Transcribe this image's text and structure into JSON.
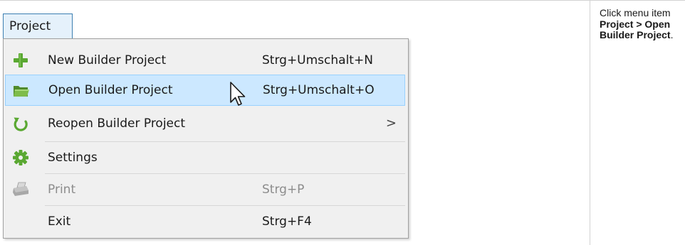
{
  "menubar": {
    "active_menu": "Project"
  },
  "menu": {
    "items": [
      {
        "label": "New Builder Project",
        "shortcut": "Strg+Umschalt+N",
        "icon": "plus-icon",
        "state": "normal"
      },
      {
        "label": "Open Builder Project",
        "shortcut": "Strg+Umschalt+O",
        "icon": "folder-open-icon",
        "state": "highlighted"
      },
      {
        "label": "Reopen Builder Project",
        "shortcut": "",
        "submenu_arrow": ">",
        "icon": "reopen-arrow-icon",
        "state": "normal"
      },
      {
        "label": "Settings",
        "shortcut": "",
        "icon": "gear-icon",
        "state": "normal"
      },
      {
        "label": "Print",
        "shortcut": "Strg+P",
        "icon": "printer-icon",
        "state": "disabled"
      },
      {
        "label": "Exit",
        "shortcut": "Strg+F4",
        "icon": "",
        "state": "normal"
      }
    ]
  },
  "instruction": {
    "prefix": "Click menu item ",
    "bold_text": "Project > Open Builder Project",
    "suffix": "."
  },
  "colors": {
    "highlight_fill": "#cce8ff",
    "highlight_border": "#99d1ff",
    "menubar_border": "#3c7fb1",
    "plus_green": "#5aa832",
    "folder_green": "#6aa13a",
    "disabled_text": "#8c8c8c"
  }
}
